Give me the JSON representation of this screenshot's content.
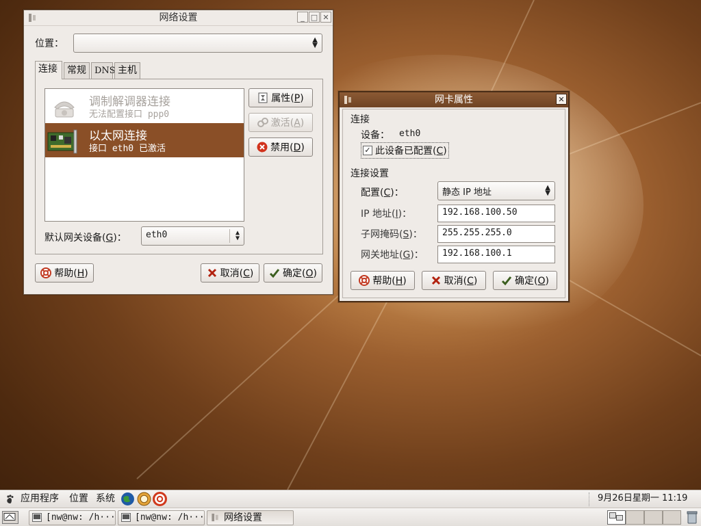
{
  "network_window": {
    "title": "网络设置",
    "location_label": "位置：",
    "location_value": "",
    "tabs": [
      "连接",
      "常规",
      "DNS",
      "主机"
    ],
    "connections": [
      {
        "name": "调制解调器连接",
        "detail": "无法配置接口 ppp0",
        "state": "disabled",
        "icon": "modem-phone-icon"
      },
      {
        "name": "以太网连接",
        "detail": "接口 eth0 已激活",
        "state": "selected",
        "icon": "ethernet-card-icon"
      }
    ],
    "properties_btn": {
      "text": "属性",
      "key": "P"
    },
    "activate_btn": {
      "text": "激活",
      "key": "A"
    },
    "deactivate_btn": {
      "text": "禁用",
      "key": "D"
    },
    "gateway_label": {
      "text": "默认网关设备",
      "key": "G",
      "suffix": "："
    },
    "gateway_value": "eth0",
    "help_btn": {
      "text": "帮助",
      "key": "H"
    },
    "cancel_btn": {
      "text": "取消",
      "key": "C"
    },
    "ok_btn": {
      "text": "确定",
      "key": "O"
    }
  },
  "nic_window": {
    "title": "网卡属性",
    "connection_heading": "连接",
    "device_label": "设备：",
    "device_value": "eth0",
    "configured_checkbox": {
      "text": "此设备已配置",
      "key": "C",
      "checked": true
    },
    "settings_heading": "连接设置",
    "config_label": {
      "text": "配置",
      "key": "C",
      "suffix": "："
    },
    "config_value": "静态 IP 地址",
    "ip_label": {
      "text": "IP 地址",
      "key": "I",
      "suffix": "："
    },
    "ip_value": "192.168.100.50",
    "mask_label": {
      "text": "子网掩码",
      "key": "S",
      "suffix": "："
    },
    "mask_value": "255.255.255.0",
    "gw_label": {
      "text": "网关地址",
      "key": "G",
      "suffix": "："
    },
    "gw_value": "192.168.100.1",
    "help_btn": {
      "text": "帮助",
      "key": "H"
    },
    "cancel_btn": {
      "text": "取消",
      "key": "C"
    },
    "ok_btn": {
      "text": "确定",
      "key": "O"
    }
  },
  "top_panel": {
    "menus": [
      "应用程序",
      "位置",
      "系统"
    ],
    "clock": "9月26日星期一  11:19"
  },
  "bottom_panel": {
    "tasks": [
      {
        "label": "[nw@nw: /h···",
        "active": false
      },
      {
        "label": "[nw@nw: /h···",
        "active": false
      },
      {
        "label": "网络设置",
        "active": true
      }
    ]
  },
  "colors": {
    "accent": "#8a4f27",
    "dialog_title": "#7a4b28"
  }
}
